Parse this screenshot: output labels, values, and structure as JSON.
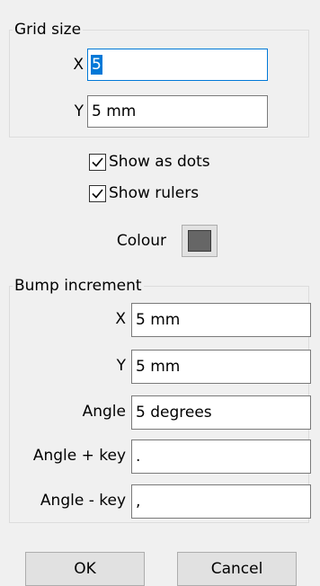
{
  "grid_size": {
    "title": "Grid size",
    "x_label": "X",
    "x_value": "5",
    "y_label": "Y",
    "y_value": "5 mm"
  },
  "options": {
    "show_dots_label": "Show as dots",
    "show_dots_checked": true,
    "show_rulers_label": "Show rulers",
    "show_rulers_checked": true,
    "colour_label": "Colour",
    "colour_swatch": "#666666"
  },
  "bump": {
    "title": "Bump increment",
    "x_label": "X",
    "x_value": "5 mm",
    "y_label": "Y",
    "y_value": "5 mm",
    "angle_label": "Angle",
    "angle_value": "5 degrees",
    "angle_plus_label": "Angle + key",
    "angle_plus_value": ".",
    "angle_minus_label": "Angle - key",
    "angle_minus_value": ","
  },
  "buttons": {
    "ok": "OK",
    "cancel": "Cancel"
  }
}
